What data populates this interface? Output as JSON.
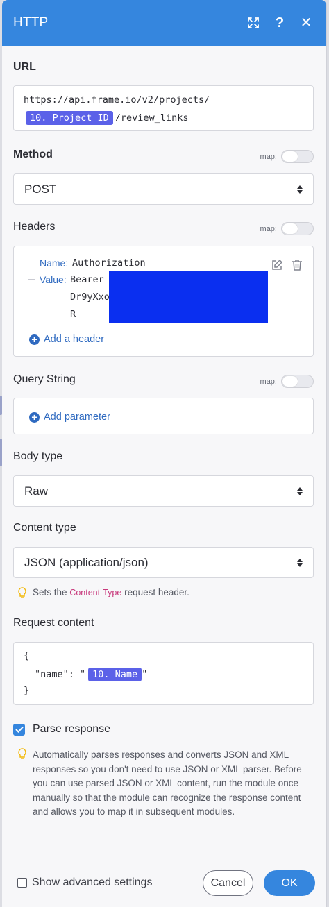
{
  "window": {
    "title": "HTTP"
  },
  "url": {
    "label": "URL",
    "prefix": "https://api.frame.io/v2/projects/",
    "pill": "10. Project ID",
    "suffix": "/review_links"
  },
  "map_label": "map:",
  "method": {
    "label": "Method",
    "value": "POST"
  },
  "headers": {
    "label": "Headers",
    "name_label": "Name:",
    "name_value": "Authorization",
    "value_label": "Value:",
    "value_line1": "Bearer",
    "value_line2": "Dr9yXxo",
    "value_line3": "R",
    "add_label": "Add a header",
    "redaction_color": "#0a2ff0"
  },
  "query": {
    "label": "Query String",
    "add_label": "Add parameter"
  },
  "body_type": {
    "label": "Body type",
    "value": "Raw"
  },
  "content_type": {
    "label": "Content type",
    "value": "JSON (application/json)",
    "hint_before": "Sets the",
    "hint_code": "Content-Type",
    "hint_after": "request header."
  },
  "request_content": {
    "label": "Request content",
    "line1": "{",
    "line2_key": "\"name\": \"",
    "line2_pill": "10. Name",
    "line2_end": "\"",
    "line3": "}"
  },
  "parse": {
    "label": "Parse response",
    "checked": true,
    "hint": "Automatically parses responses and converts JSON and XML responses so you don't need to use JSON or XML parser. Before you can use parsed JSON or XML content, run the module once manually so that the module can recognize the response content and allows you to map it in subsequent modules."
  },
  "footer": {
    "advanced_label": "Show advanced settings",
    "cancel_label": "Cancel",
    "ok_label": "OK"
  },
  "colors": {
    "accent": "#3586de",
    "pill": "#5b61e8",
    "link": "#2f6ac0"
  }
}
